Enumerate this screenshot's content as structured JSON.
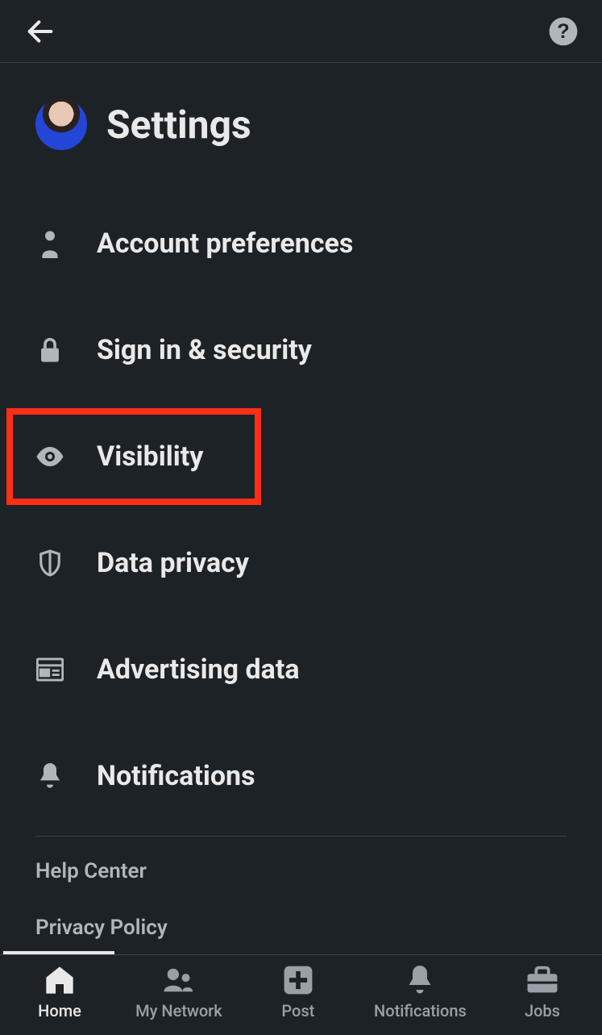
{
  "header": {
    "title": "Settings"
  },
  "menu": [
    {
      "id": "account-preferences",
      "label": "Account preferences"
    },
    {
      "id": "sign-in-security",
      "label": "Sign in & security"
    },
    {
      "id": "visibility",
      "label": "Visibility"
    },
    {
      "id": "data-privacy",
      "label": "Data privacy"
    },
    {
      "id": "advertising-data",
      "label": "Advertising data"
    },
    {
      "id": "notifications",
      "label": "Notifications"
    }
  ],
  "footer_links": [
    {
      "id": "help-center",
      "label": "Help Center"
    },
    {
      "id": "privacy-policy",
      "label": "Privacy Policy"
    }
  ],
  "bottom_nav": [
    {
      "id": "home",
      "label": "Home",
      "active": true
    },
    {
      "id": "my-network",
      "label": "My Network",
      "active": false
    },
    {
      "id": "post",
      "label": "Post",
      "active": false
    },
    {
      "id": "notifications",
      "label": "Notifications",
      "active": false
    },
    {
      "id": "jobs",
      "label": "Jobs",
      "active": false
    }
  ],
  "highlighted_menu_item": "visibility"
}
